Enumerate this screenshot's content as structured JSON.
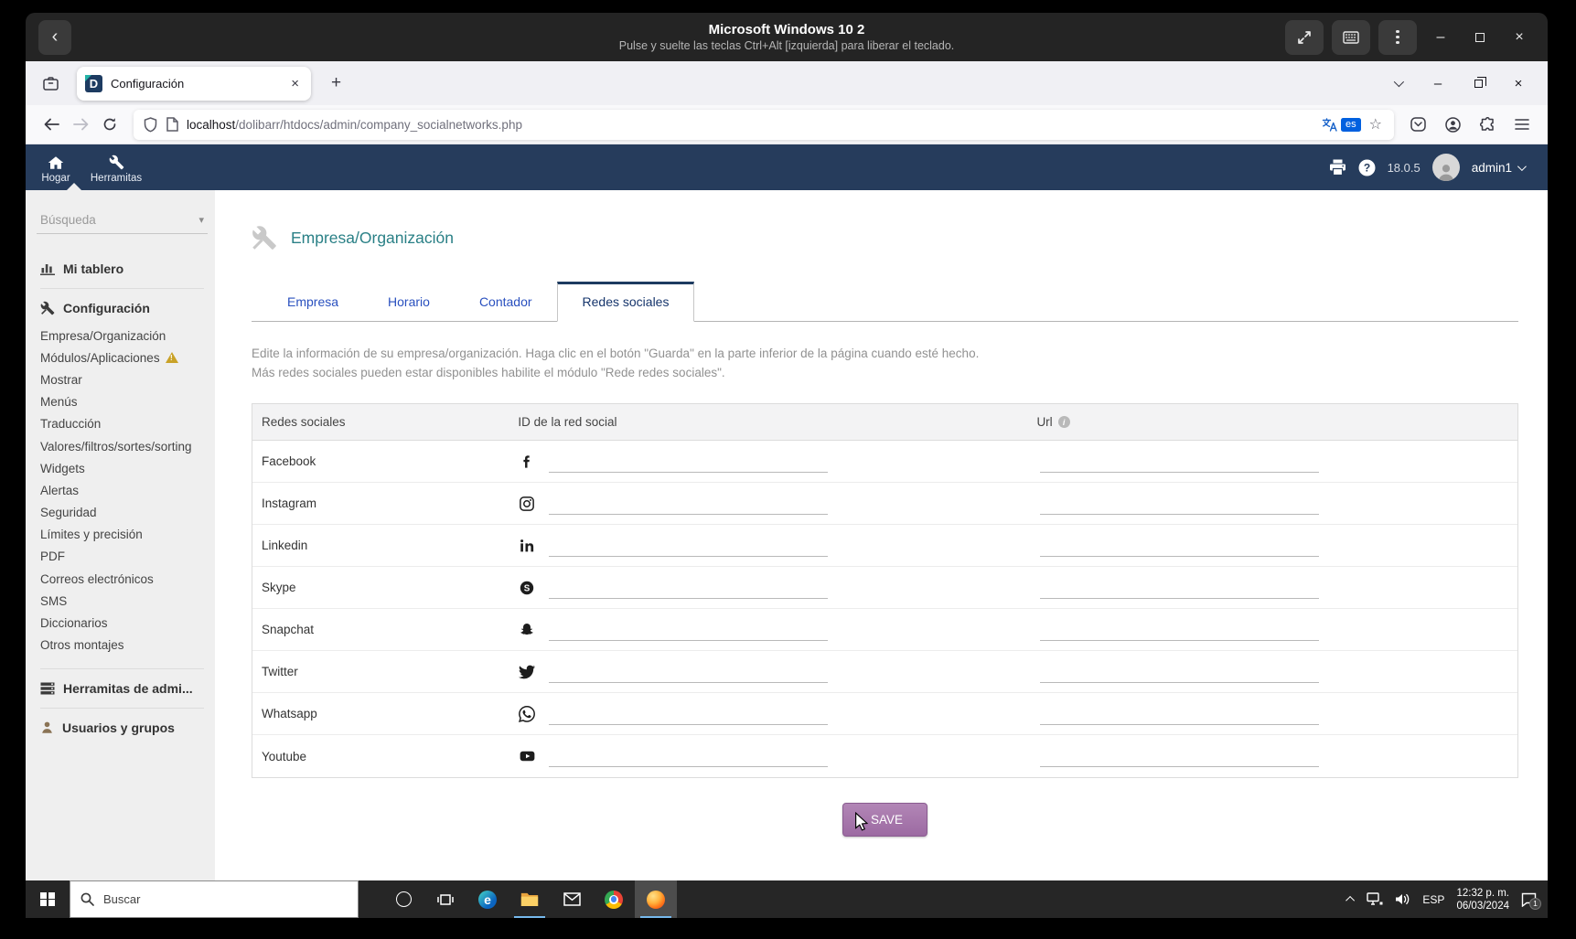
{
  "viewer": {
    "title": "Microsoft Windows 10 2",
    "subtitle": "Pulse y suelte las teclas Ctrl+Alt [izquierda] para liberar el teclado."
  },
  "glyphs": {
    "back": "‹",
    "minimize": "–",
    "close": "×",
    "plus": "+",
    "star": "☆",
    "caret_down": "▾",
    "info": "i",
    "help": "?"
  },
  "browser": {
    "tab_title": "Configuración",
    "url_host": "localhost",
    "url_path": "/dolibarr/htdocs/admin/company_socialnetworks.php",
    "translate_badge": "es"
  },
  "navbar": {
    "home": "Hogar",
    "tools": "Herramitas",
    "version": "18.0.5",
    "user": "admin1"
  },
  "sidebar": {
    "search_placeholder": "Búsqueda",
    "dashboard": "Mi tablero",
    "config_title": "Configuración",
    "config_items": [
      "Empresa/Organización",
      "Módulos/Aplicaciones",
      "Mostrar",
      "Menús",
      "Traducción",
      "Valores/filtros/sortes/sorting",
      "Widgets",
      "Alertas",
      "Seguridad",
      "Límites y precisión",
      "PDF",
      "Correos electrónicos",
      "SMS",
      "Diccionarios",
      "Otros montajes"
    ],
    "admin_tools_title": "Herramitas de admi...",
    "users_title": "Usuarios y grupos"
  },
  "main": {
    "page_title": "Empresa/Organización",
    "tabs": [
      "Empresa",
      "Horario",
      "Contador",
      "Redes sociales"
    ],
    "description_line1": "Edite la información de su empresa/organización. Haga clic en el botón \"Guarda\" en la parte inferior de la página cuando esté hecho.",
    "description_line2": "Más redes sociales pueden estar disponibles habilite el módulo \"Rede redes sociales\".",
    "table": {
      "headers": [
        "Redes sociales",
        "ID de la red social",
        "Url"
      ],
      "rows": [
        {
          "label": "Facebook",
          "icon": "facebook-icon",
          "id_value": "",
          "url_value": ""
        },
        {
          "label": "Instagram",
          "icon": "instagram-icon",
          "id_value": "",
          "url_value": ""
        },
        {
          "label": "Linkedin",
          "icon": "linkedin-icon",
          "id_value": "",
          "url_value": ""
        },
        {
          "label": "Skype",
          "icon": "skype-icon",
          "id_value": "",
          "url_value": ""
        },
        {
          "label": "Snapchat",
          "icon": "snapchat-icon",
          "id_value": "",
          "url_value": ""
        },
        {
          "label": "Twitter",
          "icon": "twitter-icon",
          "id_value": "",
          "url_value": ""
        },
        {
          "label": "Whatsapp",
          "icon": "whatsapp-icon",
          "id_value": "",
          "url_value": ""
        },
        {
          "label": "Youtube",
          "icon": "youtube-icon",
          "id_value": "",
          "url_value": ""
        }
      ]
    },
    "save_label": "SAVE"
  },
  "taskbar": {
    "search_placeholder": "Buscar",
    "lang": "ESP",
    "time": "12:32 p. m.",
    "date": "06/03/2024",
    "notif_badge": "1"
  }
}
